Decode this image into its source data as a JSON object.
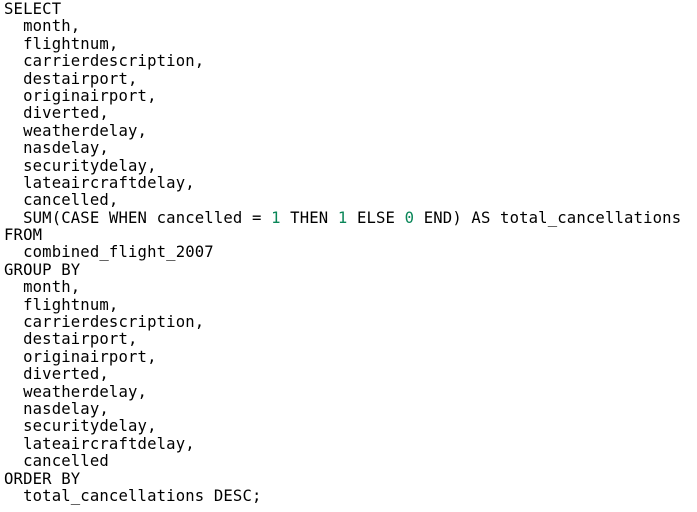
{
  "editor": {
    "language": "sql",
    "colors": {
      "text": "#000000",
      "number": "#098658",
      "background": "#ffffff"
    },
    "lines": [
      [
        {
          "t": "SELECT"
        }
      ],
      [
        {
          "t": "  month,"
        }
      ],
      [
        {
          "t": "  flightnum,"
        }
      ],
      [
        {
          "t": "  carrierdescription,"
        }
      ],
      [
        {
          "t": "  destairport,"
        }
      ],
      [
        {
          "t": "  originairport,"
        }
      ],
      [
        {
          "t": "  diverted,"
        }
      ],
      [
        {
          "t": "  weatherdelay,"
        }
      ],
      [
        {
          "t": "  nasdelay,"
        }
      ],
      [
        {
          "t": "  securitydelay,"
        }
      ],
      [
        {
          "t": "  lateaircraftdelay,"
        }
      ],
      [
        {
          "t": "  cancelled,"
        }
      ],
      [
        {
          "t": "  SUM(CASE WHEN cancelled = "
        },
        {
          "t": "1",
          "num": true
        },
        {
          "t": " THEN "
        },
        {
          "t": "1",
          "num": true
        },
        {
          "t": " ELSE "
        },
        {
          "t": "0",
          "num": true
        },
        {
          "t": " END) AS total_cancellations"
        }
      ],
      [
        {
          "t": "FROM"
        }
      ],
      [
        {
          "t": "  combined_flight_2007"
        }
      ],
      [
        {
          "t": "GROUP BY"
        }
      ],
      [
        {
          "t": "  month,"
        }
      ],
      [
        {
          "t": "  flightnum,"
        }
      ],
      [
        {
          "t": "  carrierdescription,"
        }
      ],
      [
        {
          "t": "  destairport,"
        }
      ],
      [
        {
          "t": "  originairport,"
        }
      ],
      [
        {
          "t": "  diverted,"
        }
      ],
      [
        {
          "t": "  weatherdelay,"
        }
      ],
      [
        {
          "t": "  nasdelay,"
        }
      ],
      [
        {
          "t": "  securitydelay,"
        }
      ],
      [
        {
          "t": "  lateaircraftdelay,"
        }
      ],
      [
        {
          "t": "  cancelled"
        }
      ],
      [
        {
          "t": "ORDER BY"
        }
      ],
      [
        {
          "t": "  total_cancellations DESC;"
        }
      ]
    ]
  }
}
